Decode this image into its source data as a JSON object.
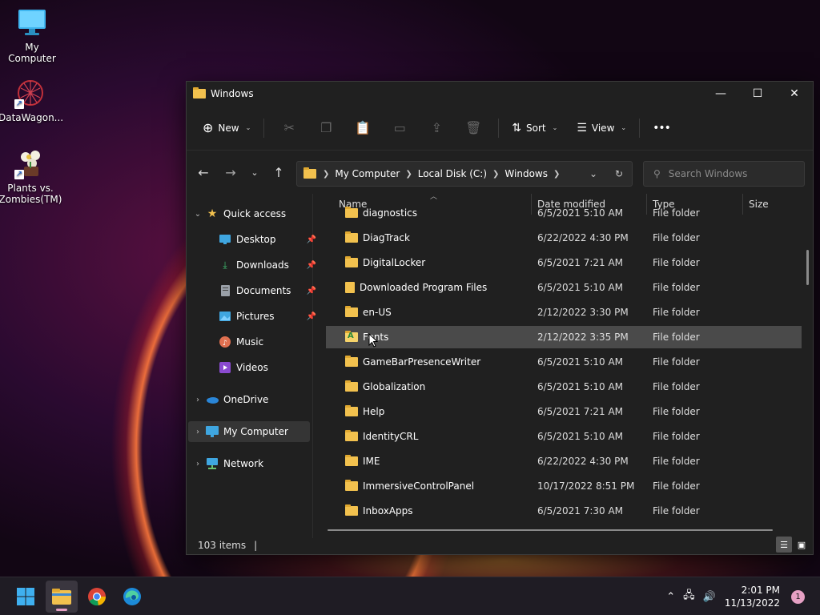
{
  "desktop": {
    "icons": [
      {
        "label": "My Computer"
      },
      {
        "label": "DataWagon..."
      },
      {
        "label": "Plants vs. Zombies(TM)"
      }
    ]
  },
  "window": {
    "title": "Windows",
    "toolbar": {
      "new_label": "New",
      "sort_label": "Sort",
      "view_label": "View",
      "more_label": "•••"
    },
    "address": {
      "crumbs": [
        "My Computer",
        "Local Disk (C:)",
        "Windows"
      ]
    },
    "search": {
      "placeholder": "Search Windows"
    },
    "nav": {
      "quick_access": "Quick access",
      "items": [
        {
          "label": "Desktop"
        },
        {
          "label": "Downloads"
        },
        {
          "label": "Documents"
        },
        {
          "label": "Pictures"
        },
        {
          "label": "Music"
        },
        {
          "label": "Videos"
        }
      ],
      "onedrive": "OneDrive",
      "my_computer": "My Computer",
      "network": "Network"
    },
    "columns": {
      "name": "Name",
      "date": "Date modified",
      "type": "Type",
      "size": "Size"
    },
    "rows": [
      {
        "name": "diagnostics",
        "date": "6/5/2021 5:10 AM",
        "type": "File folder"
      },
      {
        "name": "DiagTrack",
        "date": "6/22/2022 4:30 PM",
        "type": "File folder"
      },
      {
        "name": "DigitalLocker",
        "date": "6/5/2021 7:21 AM",
        "type": "File folder"
      },
      {
        "name": "Downloaded Program Files",
        "date": "6/5/2021 5:10 AM",
        "type": "File folder"
      },
      {
        "name": "en-US",
        "date": "2/12/2022 3:30 PM",
        "type": "File folder"
      },
      {
        "name": "Fonts",
        "date": "2/12/2022 3:35 PM",
        "type": "File folder"
      },
      {
        "name": "GameBarPresenceWriter",
        "date": "6/5/2021 5:10 AM",
        "type": "File folder"
      },
      {
        "name": "Globalization",
        "date": "6/5/2021 5:10 AM",
        "type": "File folder"
      },
      {
        "name": "Help",
        "date": "6/5/2021 7:21 AM",
        "type": "File folder"
      },
      {
        "name": "IdentityCRL",
        "date": "6/5/2021 5:10 AM",
        "type": "File folder"
      },
      {
        "name": "IME",
        "date": "6/22/2022 4:30 PM",
        "type": "File folder"
      },
      {
        "name": "ImmersiveControlPanel",
        "date": "10/17/2022 8:51 PM",
        "type": "File folder"
      },
      {
        "name": "InboxApps",
        "date": "6/5/2021 7:30 AM",
        "type": "File folder"
      }
    ],
    "status": {
      "items": "103 items"
    }
  },
  "taskbar": {
    "clock_time": "2:01 PM",
    "clock_date": "11/13/2022",
    "notifications": "1"
  }
}
